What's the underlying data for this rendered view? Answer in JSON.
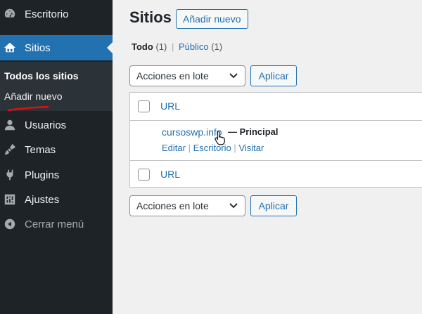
{
  "sidebar": {
    "items": [
      {
        "label": "Escritorio",
        "icon": "dashboard-icon"
      },
      {
        "label": "Sitios",
        "icon": "sites-icon"
      },
      {
        "label": "Usuarios",
        "icon": "users-icon"
      },
      {
        "label": "Temas",
        "icon": "themes-icon"
      },
      {
        "label": "Plugins",
        "icon": "plugins-icon"
      },
      {
        "label": "Ajustes",
        "icon": "settings-icon"
      },
      {
        "label": "Cerrar menú",
        "icon": "collapse-icon"
      }
    ],
    "submenu": [
      {
        "label": "Todos los sitios"
      },
      {
        "label": "Añadir nuevo"
      }
    ],
    "active_color": "#2271b1"
  },
  "main": {
    "title": "Sitios",
    "add_new": "Añadir nuevo",
    "filters": {
      "all_label": "Todo",
      "all_count": "(1)",
      "separator": "|",
      "public_label": "Público",
      "public_count": "(1)"
    },
    "bulk_actions": {
      "selected": "Acciones en lote",
      "apply": "Aplicar"
    },
    "table": {
      "column_label": "URL",
      "rows": [
        {
          "url": "cursoswp.info",
          "state": "— Principal",
          "actions": [
            "Editar",
            "Escritorio",
            "Visitar"
          ],
          "separator": "|"
        }
      ]
    }
  }
}
